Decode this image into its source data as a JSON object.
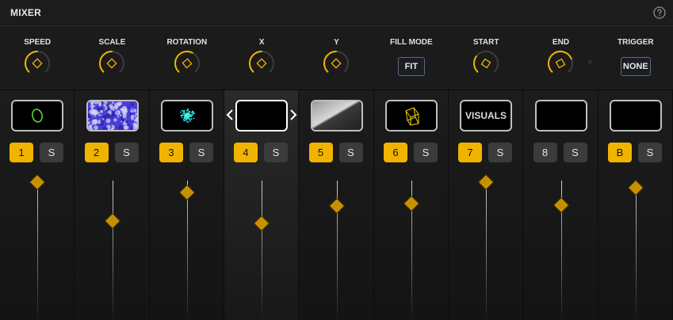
{
  "window": {
    "title": "MIXER"
  },
  "params": [
    {
      "label": "SPEED",
      "kind": "knob",
      "value": 0.5
    },
    {
      "label": "SCALE",
      "kind": "knob",
      "value": 0.5
    },
    {
      "label": "ROTATION",
      "kind": "knob",
      "value": 0.6
    },
    {
      "label": "X",
      "kind": "knob",
      "value": 0.5
    },
    {
      "label": "Y",
      "kind": "knob",
      "value": 0.5
    },
    {
      "label": "FILL MODE",
      "kind": "button",
      "value_text": "FIT"
    },
    {
      "label": "START",
      "kind": "knob",
      "value": 0.3
    },
    {
      "label": "END",
      "kind": "knob",
      "value": 0.75
    },
    {
      "label": "TRIGGER",
      "kind": "button",
      "value_text": "NONE"
    }
  ],
  "channels": [
    {
      "number": "1",
      "active": true,
      "solo": "S",
      "thumb": "green-ring",
      "level": 1.0
    },
    {
      "number": "2",
      "active": true,
      "solo": "S",
      "thumb": "blue-noise",
      "level": 0.32
    },
    {
      "number": "3",
      "active": true,
      "solo": "S",
      "thumb": "cyan-particles",
      "level": 0.82
    },
    {
      "number": "4",
      "active": true,
      "solo": "S",
      "thumb": "empty",
      "level": 0.28,
      "selected": true
    },
    {
      "number": "5",
      "active": true,
      "solo": "S",
      "thumb": "grey-gradient",
      "level": 0.58
    },
    {
      "number": "6",
      "active": true,
      "solo": "S",
      "thumb": "yellow-cube",
      "level": 0.62
    },
    {
      "number": "7",
      "active": true,
      "solo": "S",
      "thumb": "text",
      "thumb_text": "VISUALS",
      "level": 1.0
    },
    {
      "number": "8",
      "active": false,
      "solo": "S",
      "thumb": "empty",
      "level": 0.6
    },
    {
      "number": "B",
      "active": true,
      "solo": "S",
      "thumb": "empty",
      "level": 0.9
    }
  ],
  "colors": {
    "accent": "#f0b400",
    "panel": "#1b1b1b"
  },
  "icons": {
    "help": "help-circle-icon",
    "prev": "chevron-left-icon",
    "next": "chevron-right-icon"
  }
}
